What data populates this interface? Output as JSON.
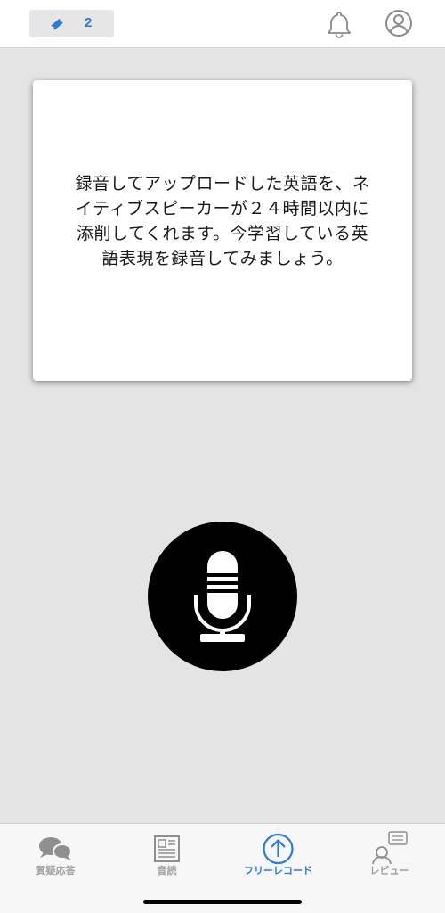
{
  "header": {
    "ticket_count": "2",
    "icons": [
      "ticket-icon",
      "bell-icon",
      "profile-icon"
    ]
  },
  "card": {
    "message": "録音してアップロードした英語を、ネイティブスピーカーが２４時間以内に添削してくれます。今学習している英語表現を録音してみましょう。"
  },
  "mic": {
    "icon": "microphone-icon"
  },
  "tabs": [
    {
      "label": "質疑応答",
      "icon": "chat-bubbles-icon",
      "active": false
    },
    {
      "label": "音読",
      "icon": "newspaper-icon",
      "active": false
    },
    {
      "label": "フリーレコード",
      "icon": "upload-arrow-icon",
      "active": true
    },
    {
      "label": "レビュー",
      "icon": "reviewer-icon",
      "active": false
    }
  ],
  "colors": {
    "accent": "#2b7bd8",
    "background": "#e4e4e4",
    "inactive_tab": "#a0a0a0"
  }
}
